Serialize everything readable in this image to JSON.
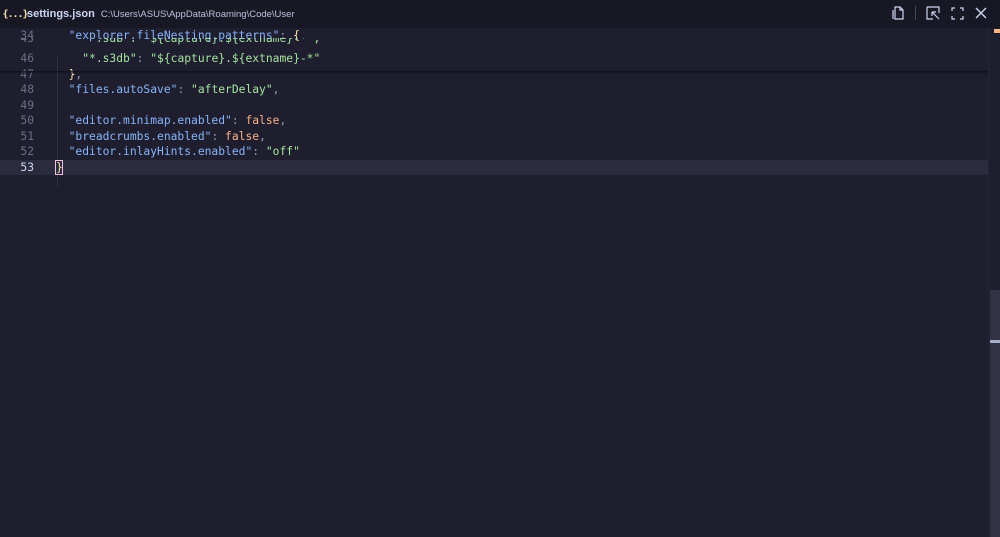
{
  "titlebar": {
    "icon_glyph": "{...}",
    "file_name": "settings.json",
    "file_path": "C:\\Users\\ASUS\\AppData\\Roaming\\Code\\User",
    "actions": [
      {
        "icon": "open-file-icon"
      },
      {
        "icon": "open-preview-icon"
      },
      {
        "icon": "maximize-icon"
      },
      {
        "icon": "close-icon"
      }
    ]
  },
  "editor": {
    "lines": [
      {
        "num": "34",
        "tokens": [
          [
            "k",
            "\"explorer.fileNesting.patterns\""
          ],
          [
            "p",
            ": "
          ],
          [
            "brk",
            "{"
          ]
        ],
        "indent": "  "
      },
      {
        "num": "45",
        "tokens": [
          [
            "s",
            "\"*.sdb\": \"${capture}.${extname}-*\","
          ]
        ],
        "indent": "    "
      },
      {
        "num": "46",
        "tokens": [
          [
            "s",
            "\"*.s3db\""
          ],
          [
            "p",
            ": "
          ],
          [
            "s",
            "\"${capture}.${extname}-*\""
          ]
        ],
        "indent": "    "
      },
      {
        "num": "47",
        "tokens": [
          [
            "brk",
            "}"
          ],
          [
            "p",
            ","
          ]
        ],
        "indent": "  "
      },
      {
        "num": "48",
        "tokens": [
          [
            "k",
            "\"files.autoSave\""
          ],
          [
            "p",
            ": "
          ],
          [
            "s",
            "\"afterDelay\""
          ],
          [
            "p",
            ","
          ]
        ],
        "indent": "  "
      },
      {
        "num": "49",
        "tokens": [],
        "indent": ""
      },
      {
        "num": "50",
        "tokens": [
          [
            "k",
            "\"editor.minimap.enabled\""
          ],
          [
            "p",
            ": "
          ],
          [
            "b",
            "false"
          ],
          [
            "p",
            ","
          ]
        ],
        "indent": "  "
      },
      {
        "num": "51",
        "tokens": [
          [
            "k",
            "\"breadcrumbs.enabled\""
          ],
          [
            "p",
            ": "
          ],
          [
            "b",
            "false"
          ],
          [
            "p",
            ","
          ]
        ],
        "indent": "  "
      },
      {
        "num": "52",
        "tokens": [
          [
            "k",
            "\"editor.inlayHints.enabled\""
          ],
          [
            "p",
            ": "
          ],
          [
            "s",
            "\"off\""
          ]
        ],
        "indent": "  "
      },
      {
        "num": "53",
        "tokens": [
          [
            "cur",
            "}"
          ]
        ],
        "indent": "",
        "current": true
      }
    ]
  },
  "colors": {
    "background": "#1e1e2e",
    "key": "#89b4fa",
    "string": "#a6e3a1",
    "boolean": "#fab387",
    "bracket": "#f9e2af",
    "cursor": "#f5c2e7"
  }
}
